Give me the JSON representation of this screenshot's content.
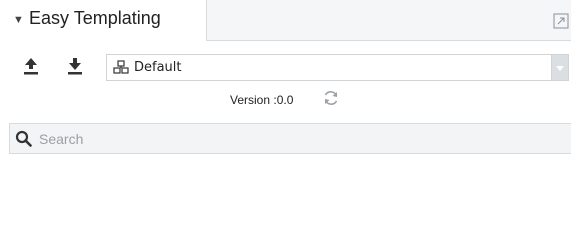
{
  "header": {
    "title": "Easy Templating",
    "collapse_icon": "caret-down-icon",
    "expand_icon": "expand-icon"
  },
  "toolbar": {
    "upload_icon": "upload-icon",
    "download_icon": "download-icon",
    "template_select": {
      "icon": "template-icon",
      "selected": "Default"
    }
  },
  "version": {
    "label": "Version :0.0",
    "refresh_icon": "refresh-icon"
  },
  "search": {
    "placeholder": "Search",
    "value": ""
  },
  "colors": {
    "header_bg": "#f4f6f8",
    "border": "#d6dbe0",
    "icon_dark": "#333333",
    "select_arrow_bg": "#dcdfe2"
  }
}
